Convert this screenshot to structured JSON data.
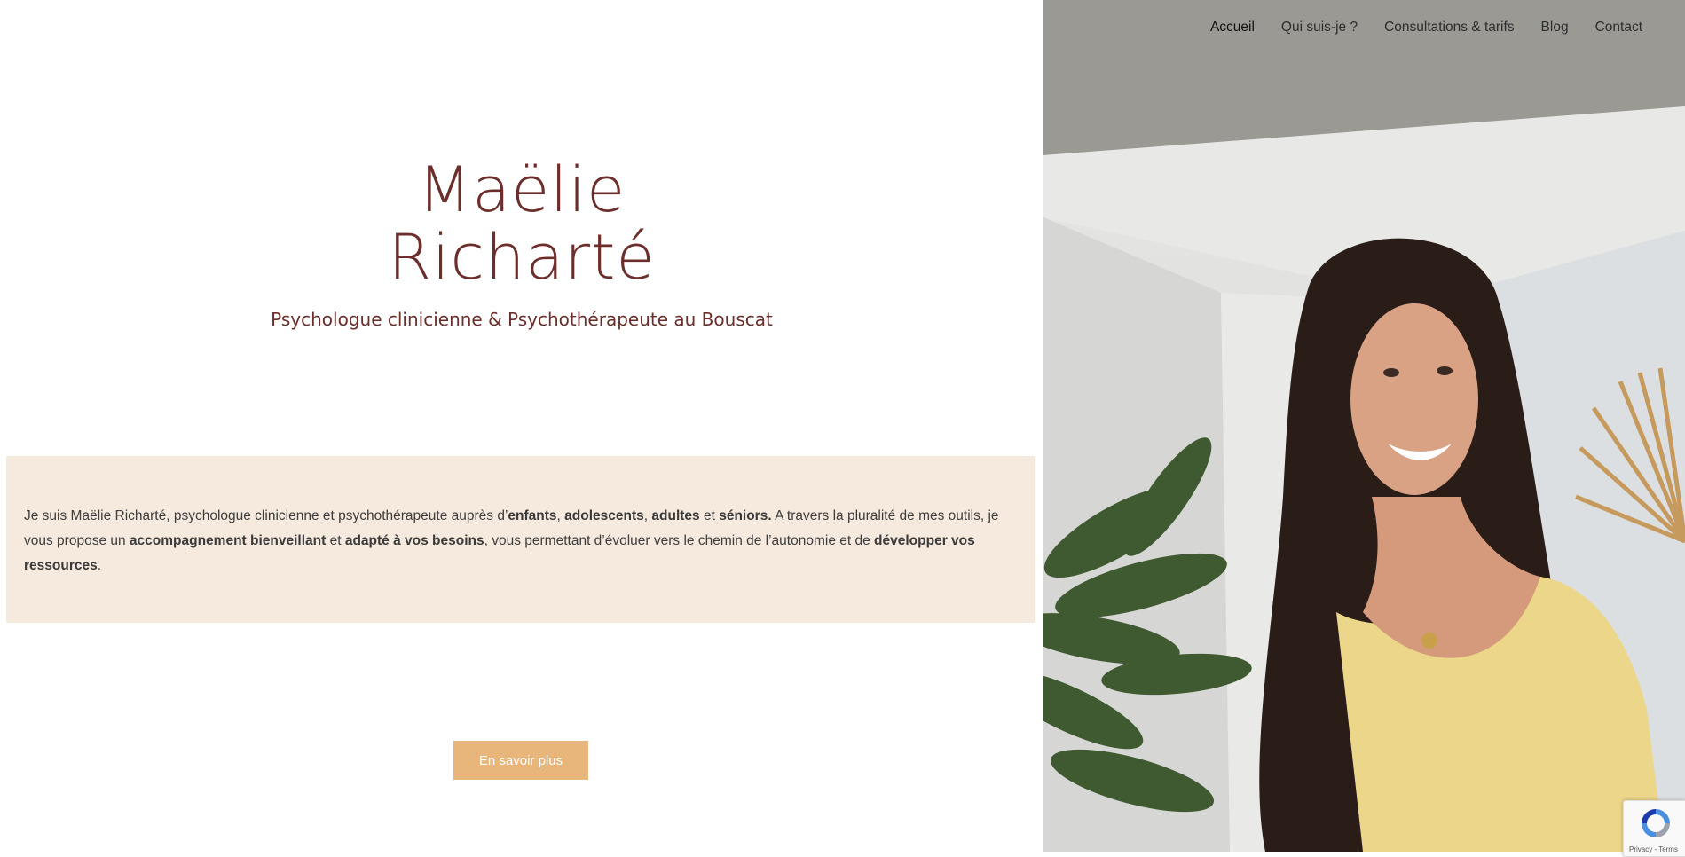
{
  "nav": {
    "items": [
      {
        "label": "Accueil",
        "active": true
      },
      {
        "label": "Qui suis-je ?"
      },
      {
        "label": "Consultations & tarifs"
      },
      {
        "label": "Blog"
      },
      {
        "label": "Contact"
      }
    ]
  },
  "hero": {
    "name_line1": "Maëlie",
    "name_line2": "Richarté",
    "subtitle": "Psychologue clinicienne & Psychothérapeute au Bouscat"
  },
  "intro": {
    "parts": [
      {
        "text": "Je suis Maëlie Richarté, psychologue clinicienne et psychothérapeute auprès d’"
      },
      {
        "text": "enfants",
        "bold": true
      },
      {
        "text": ", "
      },
      {
        "text": "adolescents",
        "bold": true
      },
      {
        "text": ", "
      },
      {
        "text": "adultes",
        "bold": true
      },
      {
        "text": " et "
      },
      {
        "text": "séniors.",
        "bold": true
      },
      {
        "text": " A travers la pluralité de mes outils, je vous propose un "
      },
      {
        "text": "accompagnement bienveillant",
        "bold": true
      },
      {
        "text": " et "
      },
      {
        "text": "adapté à vos besoins",
        "bold": true
      },
      {
        "text": ", vous permettant d’évoluer vers le chemin de l’autonomie et de "
      },
      {
        "text": "développer vos ressources",
        "bold": true
      },
      {
        "text": "."
      }
    ]
  },
  "cta": {
    "label": "En savoir plus"
  },
  "recaptcha": {
    "footer": "Privacy - Terms"
  },
  "colors": {
    "brand": "#6b2e2b",
    "accent": "#e8b57a",
    "intro_background": "#f6eadf"
  }
}
